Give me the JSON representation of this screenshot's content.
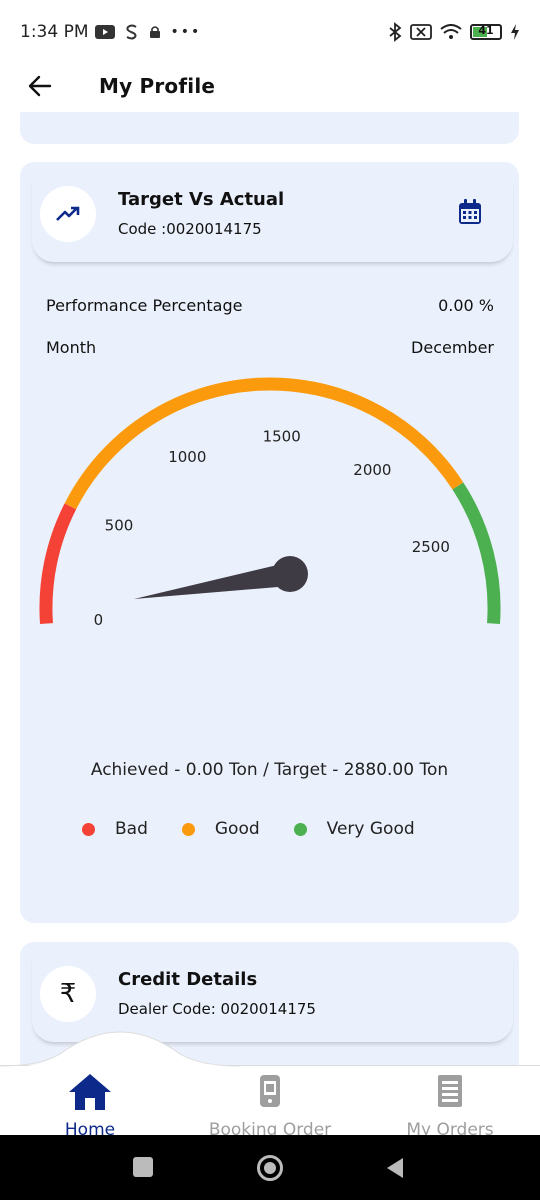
{
  "status_bar": {
    "time": "1:34 PM",
    "dots": "•••",
    "battery": "41"
  },
  "header": {
    "title": "My Profile"
  },
  "target_card": {
    "title": "Target Vs Actual",
    "code": "Code :0020014175",
    "rows": [
      {
        "label": "Performance Percentage",
        "value": "0.00 %"
      },
      {
        "label": "Month",
        "value": "December"
      }
    ],
    "gauge": {
      "min": 0,
      "max": 2880,
      "value": 0,
      "ticks": [
        "0",
        "500",
        "1000",
        "1500",
        "2000",
        "2500"
      ],
      "colors": {
        "bad": "#f44336",
        "good": "#fb9a0c",
        "very_good": "#4caf50",
        "needle": "#3e3b45"
      }
    },
    "summary": "Achieved - 0.00 Ton / Target - 2880.00 Ton",
    "legend": [
      {
        "label": "Bad",
        "color": "#f44336"
      },
      {
        "label": "Good",
        "color": "#fb9a0c"
      },
      {
        "label": "Very Good",
        "color": "#4caf50"
      }
    ]
  },
  "credit_card": {
    "title": "Credit Details",
    "dealer_code": "Dealer Code: 0020014175",
    "currency_symbol": "₹"
  },
  "bottom_nav": {
    "items": [
      {
        "label": "Home",
        "icon": "home-icon",
        "active": true
      },
      {
        "label": "Booking Order",
        "icon": "booking-order-icon",
        "active": false
      },
      {
        "label": "My Orders",
        "icon": "my-orders-icon",
        "active": false
      }
    ],
    "active_color": "#0d2a8a",
    "inactive_color": "#9e9e9e"
  }
}
